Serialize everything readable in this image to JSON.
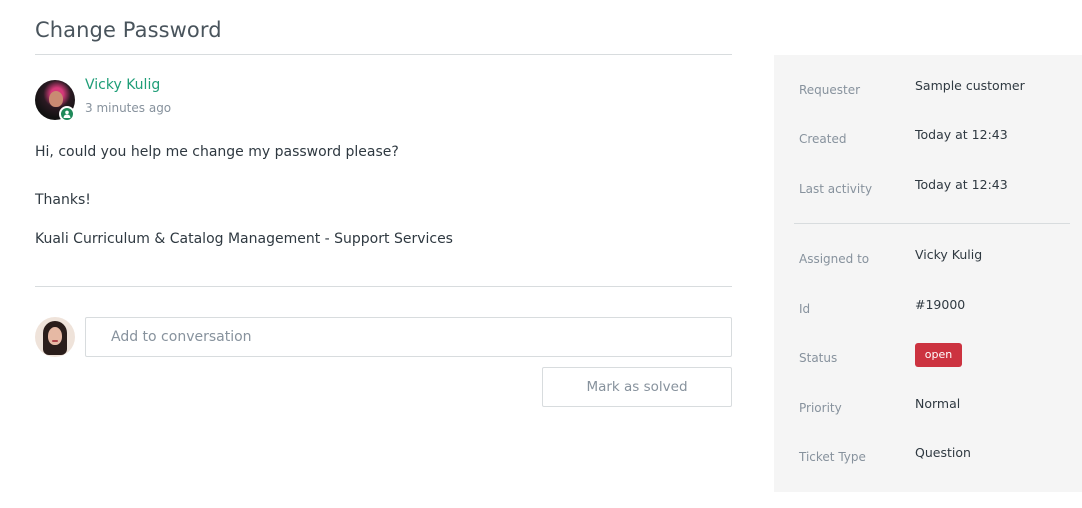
{
  "page_title": "Change Password",
  "message": {
    "author": "Vicky Kulig",
    "timestamp": "3 minutes ago",
    "lines": [
      "Hi, could you help me change my password please?",
      "Thanks!",
      "Kuali Curriculum & Catalog Management - Support Services"
    ]
  },
  "reply": {
    "placeholder": "Add to conversation",
    "solve_button": "Mark as solved"
  },
  "details": {
    "requester": {
      "label": "Requester",
      "value": "Sample customer"
    },
    "created": {
      "label": "Created",
      "value": "Today at 12:43"
    },
    "last_activity": {
      "label": "Last activity",
      "value": "Today at 12:43"
    },
    "assigned_to": {
      "label": "Assigned to",
      "value": "Vicky Kulig"
    },
    "id": {
      "label": "Id",
      "value": "#19000"
    },
    "status": {
      "label": "Status",
      "value": "open",
      "color": "#cc3340"
    },
    "priority": {
      "label": "Priority",
      "value": "Normal"
    },
    "ticket_type": {
      "label": "Ticket Type",
      "value": "Question"
    }
  },
  "colors": {
    "author_link": "#1f9e78",
    "agent_badge": "#1f8a5a",
    "sidebar_bg": "#f5f5f5"
  },
  "icons": {
    "agent_badge": "user-icon"
  }
}
